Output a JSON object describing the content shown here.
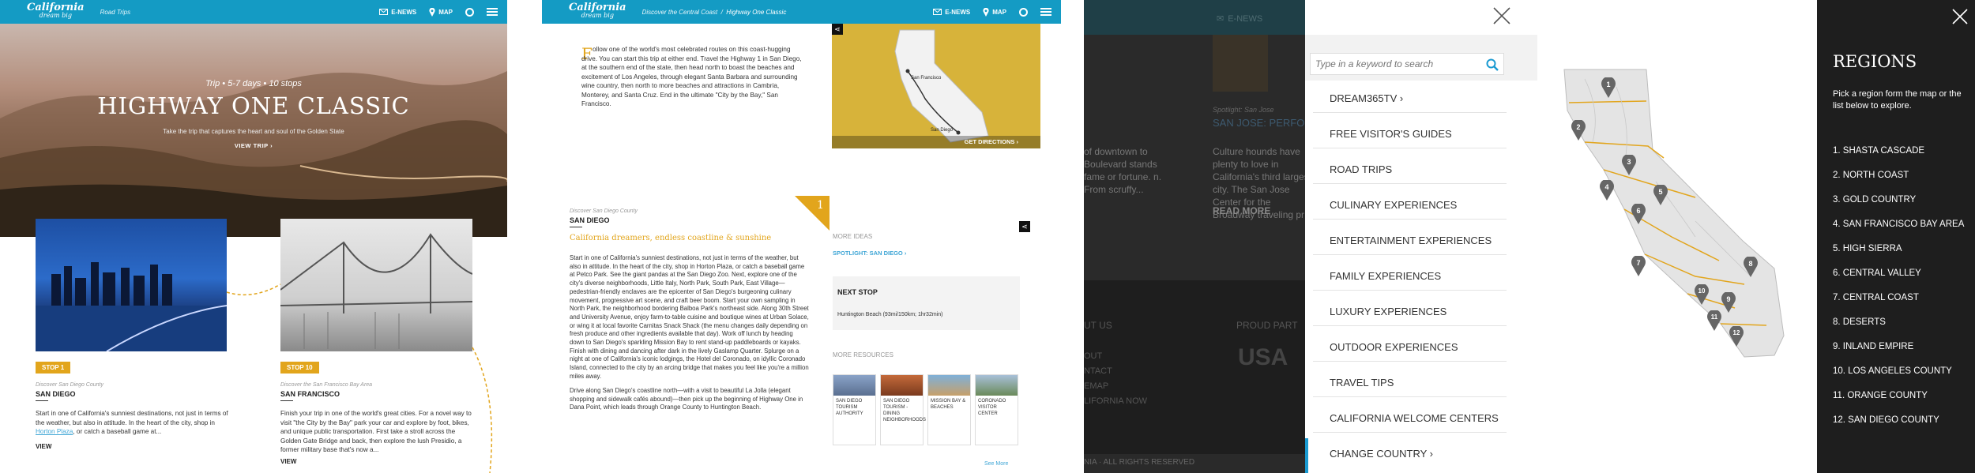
{
  "header": {
    "logo_top": "California",
    "logo_bottom": "dream big",
    "enews": "E-NEWS",
    "map": "MAP"
  },
  "panel1": {
    "crumb": "Road Trips",
    "hero_meta": "Trip  •  5-7 days  •  10 stops",
    "hero_title": "HIGHWAY ONE CLASSIC",
    "hero_sub": "Take the trip that captures the heart and soul of the Golden State",
    "view_trip": "VIEW TRIP",
    "stops": [
      {
        "tag": "STOP 1",
        "eyebrow": "Discover San Diego County",
        "name": "SAN DIEGO",
        "text": "Start in one of California's sunniest destinations, not just in terms of the weather, but also in attitude. In the heart of the city, shop in",
        "link": "Horton Plaza",
        "text2": ", or catch a baseball game at...",
        "view": "VIEW"
      },
      {
        "tag": "STOP 10",
        "eyebrow": "Discover the San Francisco Bay Area",
        "name": "SAN FRANCISCO",
        "text": "Finish your trip in one of the world's great cities. For a novel way to visit \"the City by the Bay\" park your car and explore by foot, bikes, and unique public transportation. First take a stroll across the Golden Gate Bridge and back, then explore the lush Presidio, a former military base that's now a...",
        "view": "VIEW"
      }
    ]
  },
  "panel2": {
    "crumb1": "Discover the Central Coast",
    "crumb2": "Highway One Classic",
    "intro_drop": "F",
    "intro": "ollow one of the world's most celebrated routes on this coast-hugging drive. You can start this trip at either end. Travel the Highway 1 in San Diego, at the southern end of the state, then head north to boast the beaches and excitement of Los Angeles, through elegant Santa Barbara and surrounding wine country, then north to more beaches and attractions in Cambria, Monterey, and Santa Cruz. End in the ultimate \"City by the Bay,\" San Francisco.",
    "map_city1": "San Francisco",
    "map_city2": "San Diego",
    "directions": "GET DIRECTIONS",
    "eyebrow": "Discover San Diego County",
    "stop_name": "SAN DIEGO",
    "stop_number": "1",
    "tagline": "California dreamers, endless coastline & sunshine",
    "para1": "Start in one of California's sunniest destinations, not just in terms of the weather, but also in attitude. In the heart of the city, shop in Horton Plaza, or catch a baseball game at Petco Park. See the giant pandas at the San Diego Zoo. Next, explore one of the city's diverse neighborhoods, Little Italy, North Park, South Park, East Village—pedestrian-friendly enclaves are the epicenter of San Diego's burgeoning culinary movement, progressive art scene, and craft beer boom. Start your own sampling in North Park, the neighborhood bordering Balboa Park's northeast side. Along 30th Street and University Avenue, enjoy farm-to-table cuisine and boutique wines at Urban Solace, or wing it at local favorite Carnitas Snack Shack (the menu changes daily depending on fresh produce and other ingredients available that day). Work off lunch by heading down to San Diego's sparkling Mission Bay to rent stand-up paddleboards or kayaks. Finish with dining and dancing after dark in the lively Gaslamp Quarter. Splurge on a night at one of California's iconic lodgings, the Hotel del Coronado, on idyllic Coronado Island, connected to the city by an arcing bridge that makes you feel like you're a million miles away.",
    "para2": "Drive along San Diego's coastline north—with a visit to beautiful La Jolla (elegant shopping and sidewalk cafés abound)—then pick up the beginning of Highway One in Dana Point, which leads through Orange County to Huntington Beach.",
    "more_ideas": "MORE IDEAS",
    "spotlight": "SPOTLIGHT: SAN DIEGO",
    "next_stop_title": "NEXT STOP",
    "next_stop": "Huntington Beach (93mi/150km; 1hr32min)",
    "more_resources": "MORE RESOURCES",
    "resources": [
      "SAN DIEGO TOURISM AUTHORITY",
      "SAN DIEGO TOURISM - DINING NEIGHBORHOODS",
      "MISSION BAY & BEACHES",
      "CORONADO VISITOR CENTER"
    ],
    "see_more": "See More"
  },
  "panel3": {
    "enews": "E-NEWS",
    "text1": "of downtown to Boulevard stands fame or fortune. n. From scruffy...",
    "spot_eyebrow": "Spotlight: San Jose",
    "spot_title": "SAN JOSE: PERFORMI",
    "spot_text": "Culture hounds have plenty to love in California's third largest city. The San Jose Center for the Broadway traveling pr",
    "read_more": "READ MORE",
    "about": "UT US",
    "footer_links": [
      "OUT",
      "NTACT",
      "EMAP",
      "LIFORNIA NOW"
    ],
    "partner": "PROUD PART",
    "usa": "USA",
    "rights": "NIA · ALL RIGHTS RESERVED",
    "search_placeholder": "Type in a keyword to search",
    "menu": [
      "DREAM365TV",
      "FREE VISITOR'S GUIDES",
      "ROAD TRIPS",
      "CULINARY EXPERIENCES",
      "ENTERTAINMENT EXPERIENCES",
      "FAMILY EXPERIENCES",
      "LUXURY EXPERIENCES",
      "OUTDOOR EXPERIENCES",
      "TRAVEL TIPS",
      "CALIFORNIA WELCOME CENTERS",
      "CHANGE COUNTRY"
    ]
  },
  "panel4": {
    "title": "REGIONS",
    "subtitle": "Pick a region form the map or the list below to explore.",
    "regions": [
      "1. SHASTA CASCADE",
      "2. NORTH COAST",
      "3. GOLD COUNTRY",
      "4. SAN FRANCISCO BAY AREA",
      "5. HIGH SIERRA",
      "6. CENTRAL VALLEY",
      "7. CENTRAL COAST",
      "8. DESERTS",
      "9. INLAND EMPIRE",
      "10. LOS ANGELES COUNTY",
      "11. ORANGE COUNTY",
      "12. SAN DIEGO COUNTY"
    ],
    "pins": [
      "1",
      "2",
      "3",
      "4",
      "5",
      "6",
      "7",
      "8",
      "9",
      "10",
      "11",
      "12"
    ]
  },
  "colors": {
    "brand_blue": "#149bc4",
    "gold": "#e2a51c",
    "link": "#3fa6d6",
    "dark": "#1e1e1e"
  }
}
